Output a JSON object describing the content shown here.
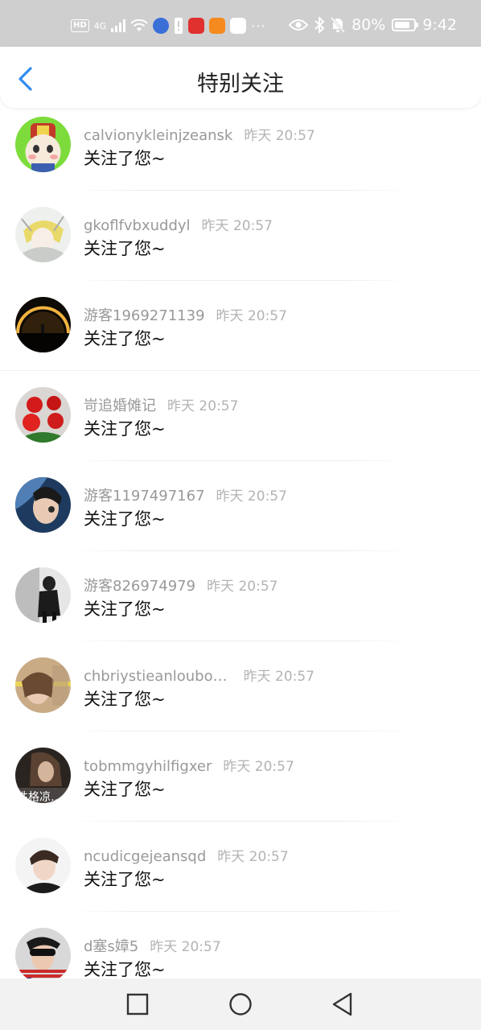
{
  "status_bar": {
    "hd": "HD",
    "signal_text": "4G",
    "battery": "80%",
    "battery_level": 0.8,
    "time": "9:42",
    "more": "···"
  },
  "header": {
    "title": "特别关注"
  },
  "items": [
    {
      "name": "calvionykleinjzeansk",
      "time": "昨天 20:57",
      "message": "关注了您~"
    },
    {
      "name": "gkoflfvbxuddyl",
      "time": "昨天 20:57",
      "message": "关注了您~"
    },
    {
      "name": "游客1969271139",
      "time": "昨天 20:57",
      "message": "关注了您~"
    },
    {
      "name": "岢追婚傩记",
      "time": "昨天 20:57",
      "message": "关注了您~"
    },
    {
      "name": "游客1197497167",
      "time": "昨天 20:57",
      "message": "关注了您~"
    },
    {
      "name": "游客826974979",
      "time": "昨天 20:57",
      "message": "关注了您~"
    },
    {
      "name": "chbriystieanloubo…",
      "time": "昨天 20:57",
      "message": "关注了您~"
    },
    {
      "name": "tobmmgyhilfigxer",
      "time": "昨天 20:57",
      "message": "关注了您~"
    },
    {
      "name": "ncudicgejeansqd",
      "time": "昨天 20:57",
      "message": "关注了您~"
    },
    {
      "name": "d塞s嫜5",
      "time": "昨天 20:57",
      "message": "关注了您~"
    }
  ],
  "avatar_overlay_text": "性格凉…",
  "colors": {
    "accent": "#2f8cf0",
    "status_bar": "#cfcfcf"
  }
}
